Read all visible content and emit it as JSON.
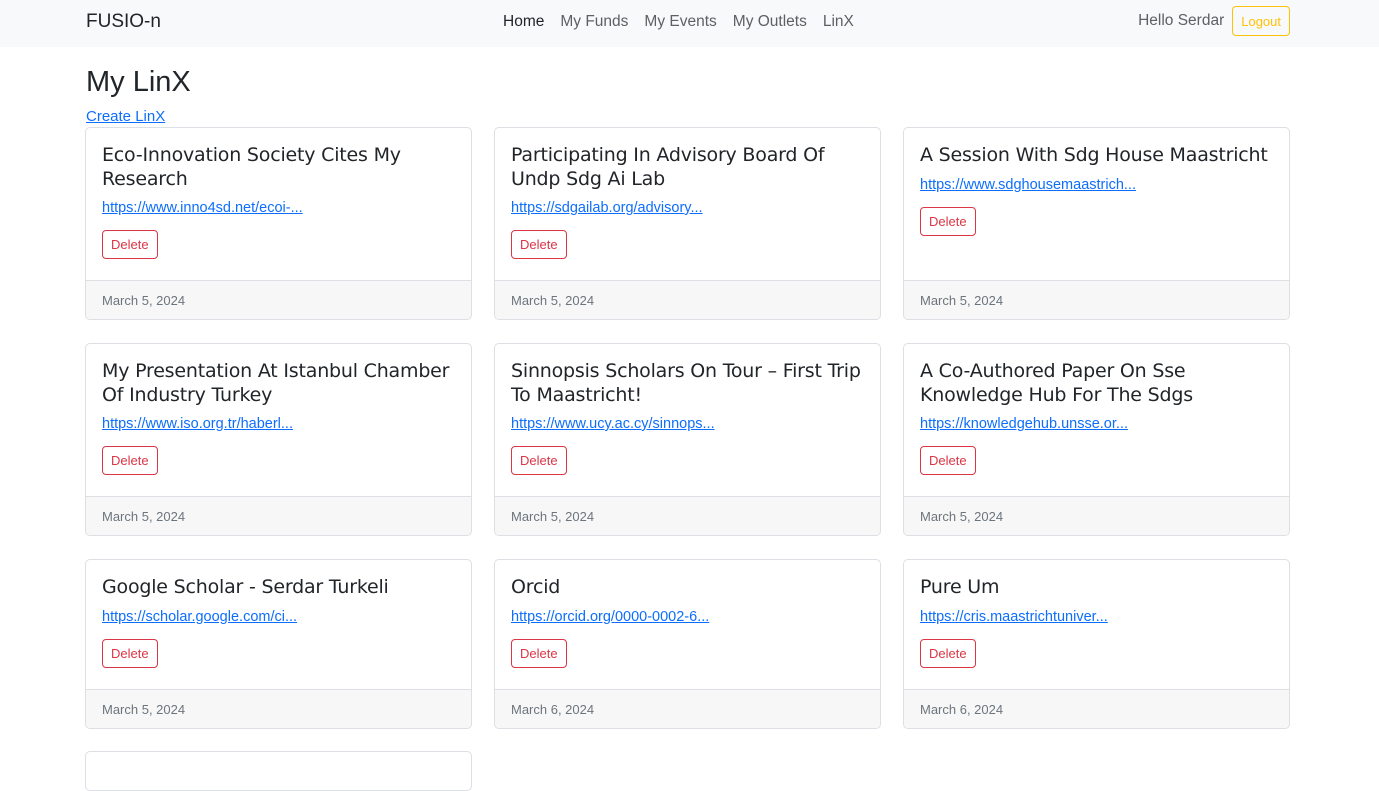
{
  "navbar": {
    "brand": "FUSIO-n",
    "links": [
      "Home",
      "My Funds",
      "My Events",
      "My Outlets",
      "LinX"
    ],
    "greeting": "Hello Serdar",
    "logout_label": "Logout"
  },
  "page": {
    "title": "My LinX",
    "create_link": "Create LinX"
  },
  "cards": [
    {
      "title": "Eco-Innovation Society Cites My Research",
      "url": "https://www.inno4sd.net/ecoi-...",
      "delete_label": "Delete",
      "date": "March 5, 2024"
    },
    {
      "title": "Participating In Advisory Board Of Undp Sdg Ai Lab",
      "url": "https://sdgailab.org/advisory...",
      "delete_label": "Delete",
      "date": "March 5, 2024"
    },
    {
      "title": "A Session With Sdg House Maastricht",
      "url": "https://www.sdghousemaastrich...",
      "delete_label": "Delete",
      "date": "March 5, 2024"
    },
    {
      "title": "My Presentation At Istanbul Chamber Of Industry Turkey",
      "url": "https://www.iso.org.tr/haberl...",
      "delete_label": "Delete",
      "date": "March 5, 2024"
    },
    {
      "title": "Sinnopsis Scholars On Tour – First Trip To Maastricht!",
      "url": "https://www.ucy.ac.cy/sinnops...",
      "delete_label": "Delete",
      "date": "March 5, 2024"
    },
    {
      "title": "A Co-Authored Paper On Sse Knowledge Hub For The Sdgs",
      "url": "https://knowledgehub.unsse.or...",
      "delete_label": "Delete",
      "date": "March 5, 2024"
    },
    {
      "title": "Google Scholar - Serdar Turkeli",
      "url": "https://scholar.google.com/ci...",
      "delete_label": "Delete",
      "date": "March 5, 2024"
    },
    {
      "title": "Orcid",
      "url": "https://orcid.org/0000-0002-6...",
      "delete_label": "Delete",
      "date": "March 6, 2024"
    },
    {
      "title": "Pure Um",
      "url": "https://cris.maastrichtuniver...",
      "delete_label": "Delete",
      "date": "March 6, 2024"
    }
  ],
  "colors": {
    "navbar_bg": "#f8f9fa",
    "link": "#0d6efd",
    "delete": "#dc3545",
    "logout": "#ffc107"
  }
}
